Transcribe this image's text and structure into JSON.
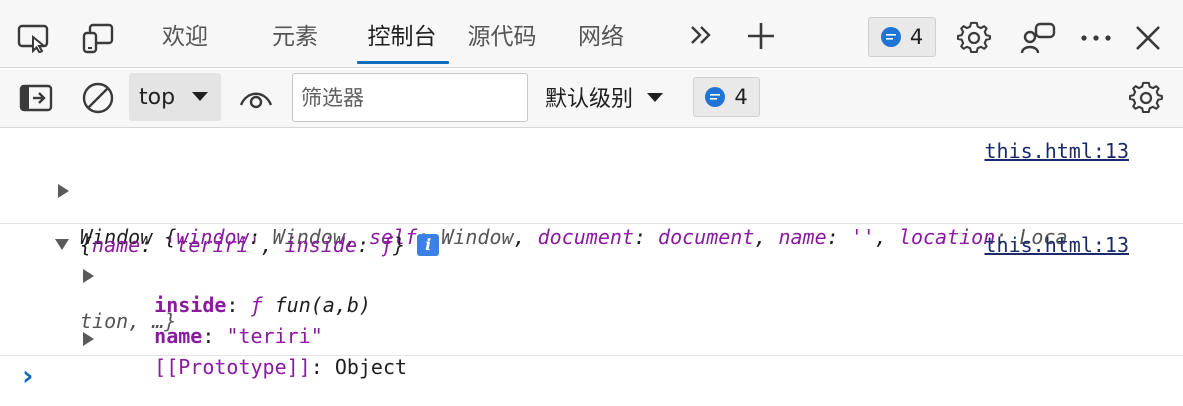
{
  "tabbar": {
    "tabs": [
      {
        "label": "欢迎"
      },
      {
        "label": "元素"
      },
      {
        "label": "控制台"
      },
      {
        "label": "源代码"
      },
      {
        "label": "网络"
      }
    ],
    "issues_count": "4"
  },
  "toolbar": {
    "context": "top",
    "filter_placeholder": "筛选器",
    "log_level": "默认级别",
    "issues_count": "4"
  },
  "console": {
    "entries": [
      {
        "source": "this.html:13",
        "text": [
          {
            "t": "Window {",
            "c": "p"
          },
          {
            "t": "window",
            "c": "k"
          },
          {
            "t": ": ",
            "c": "p"
          },
          {
            "t": "Window",
            "c": "v"
          },
          {
            "t": ", ",
            "c": "p"
          },
          {
            "t": "self",
            "c": "k"
          },
          {
            "t": ": ",
            "c": "p"
          },
          {
            "t": "Window",
            "c": "v"
          },
          {
            "t": ", ",
            "c": "p"
          },
          {
            "t": "document",
            "c": "k"
          },
          {
            "t": ": ",
            "c": "p"
          },
          {
            "t": "document",
            "c": "s"
          },
          {
            "t": ", ",
            "c": "p"
          },
          {
            "t": "name",
            "c": "k"
          },
          {
            "t": ": ",
            "c": "p"
          },
          {
            "t": "''",
            "c": "s"
          },
          {
            "t": ", ",
            "c": "p"
          },
          {
            "t": "location",
            "c": "k"
          },
          {
            "t": ": Loca",
            "c": "v"
          }
        ],
        "text_line2": "tion, …}"
      },
      {
        "source": "this.html:13",
        "summary": [
          {
            "t": "{",
            "c": "p"
          },
          {
            "t": "name",
            "c": "k"
          },
          {
            "t": ": ",
            "c": "p"
          },
          {
            "t": "'teriri'",
            "c": "s"
          },
          {
            "t": ", ",
            "c": "p"
          },
          {
            "t": "inside",
            "c": "k"
          },
          {
            "t": ": ",
            "c": "p"
          },
          {
            "t": "ƒ",
            "c": "s"
          },
          {
            "t": "}",
            "c": "p"
          }
        ],
        "info_glyph": "i",
        "props": {
          "inside_key": "inside",
          "inside_value_f": "ƒ",
          "inside_value": "fun(a,b)",
          "name_key": "name",
          "name_value": "\"teriri\"",
          "proto_key": "[[Prototype]]",
          "proto_value": "Object"
        }
      }
    ],
    "prompt": "›"
  },
  "colors": {
    "accent": "#0f6cbd",
    "key": "#8a1aa0",
    "link": "#1a2a6c",
    "badge": "#1f74d6"
  }
}
